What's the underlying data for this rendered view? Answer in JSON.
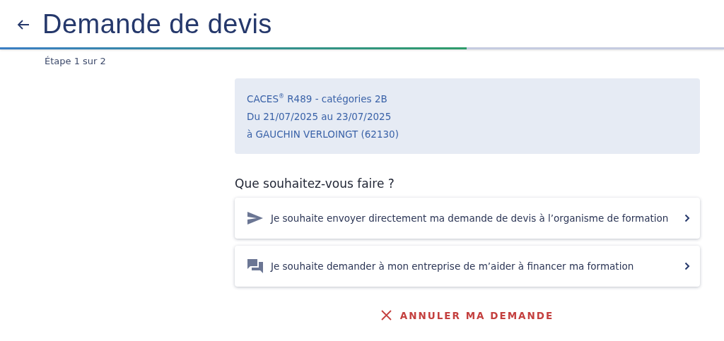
{
  "header": {
    "title": "Demande de devis",
    "progress": {
      "level": 0.645
    },
    "step": "Étape 1 sur 2"
  },
  "summary": {
    "lines": [
      "CACES$^{®}$ R489 - catégories 2B",
      "Du 21/07/2025 au 23/07/2025",
      "à GAUCHIN VERLOINGT (62130)"
    ]
  },
  "question": "Que souhaitez-vous faire ?",
  "options": [
    {
      "kind": "send",
      "label": "Je souhaite envoyer directement ma demande de devis à l’organisme de formation"
    },
    {
      "kind": "chat",
      "label": "Je souhaite demander à mon entreprise de m’aider à financer ma formation"
    }
  ],
  "cancel": "ANNULER MA DEMANDE"
}
